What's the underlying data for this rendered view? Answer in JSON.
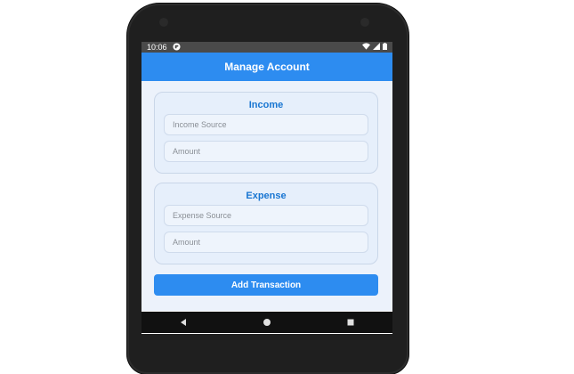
{
  "status_bar": {
    "time": "10:06"
  },
  "app_bar": {
    "title": "Manage Account"
  },
  "income": {
    "title": "Income",
    "source_placeholder": "Income Source",
    "amount_placeholder": "Amount"
  },
  "expense": {
    "title": "Expense",
    "source_placeholder": "Expense Source",
    "amount_placeholder": "Amount"
  },
  "add_button": {
    "label": "Add Transaction"
  },
  "bottom_nav": {
    "items": [
      {
        "icon": "transactions-icon"
      },
      {
        "icon": "accounts-icon"
      },
      {
        "icon": "pie-chart-icon"
      },
      {
        "icon": "gear-icon"
      }
    ]
  },
  "colors": {
    "primary": "#2d8cf0",
    "title_text": "#1976d2",
    "screen_bg": "#ecf2fb"
  }
}
